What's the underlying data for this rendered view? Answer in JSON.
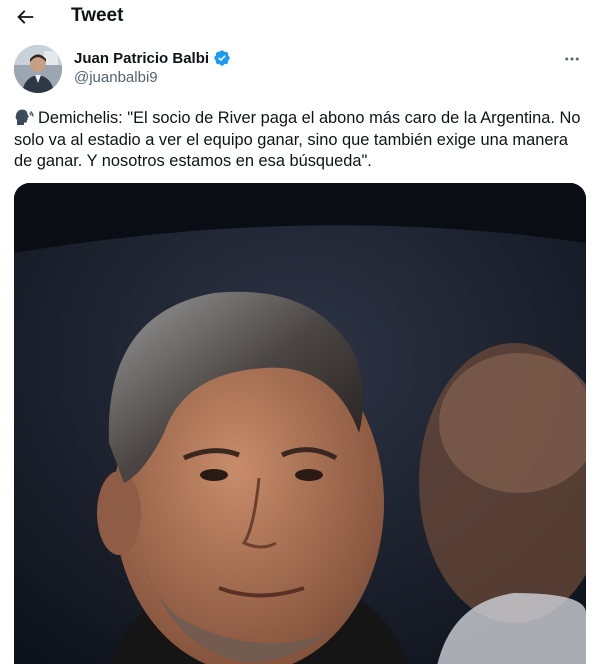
{
  "header": {
    "title": "Tweet"
  },
  "author": {
    "display_name": "Juan Patricio Balbi",
    "handle": "@juanbalbi9",
    "verified": true
  },
  "tweet": {
    "emoji": "speaking-head-icon",
    "text": "Demichelis: \"El socio de River paga el abono más caro de la Argentina. No solo va al estadio a ver el equipo ganar, sino que también exige una manera de ganar. Y nosotros estamos en esa búsqueda\"."
  },
  "colors": {
    "verified_blue": "#1d9bf0",
    "text_primary": "#0f1419",
    "text_secondary": "#536471"
  }
}
